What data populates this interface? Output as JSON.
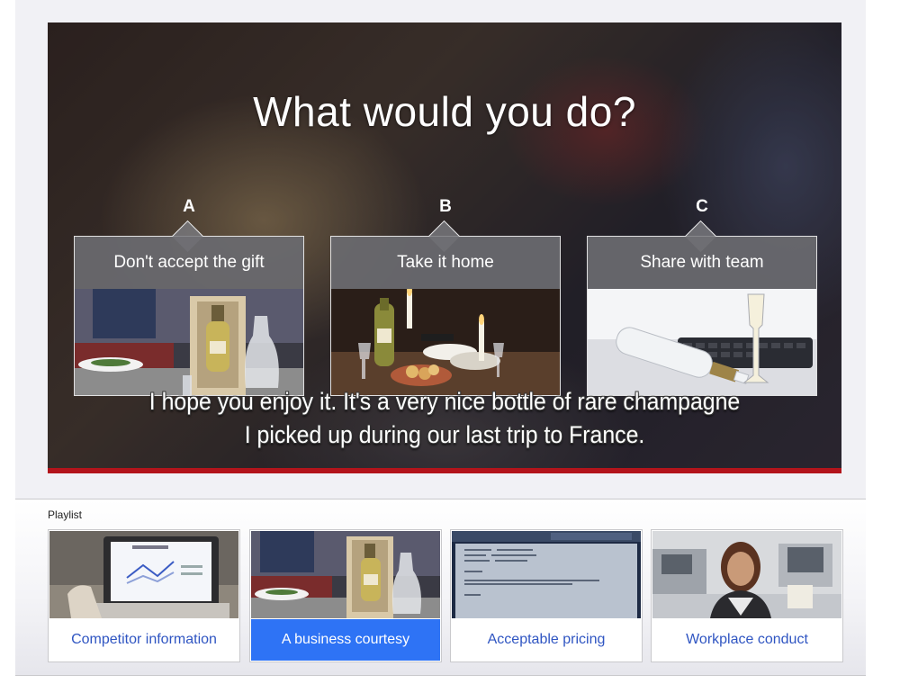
{
  "video": {
    "question": "What would you do?",
    "subtitle_line1": "I hope you enjoy it. It's a very nice bottle of rare champagne",
    "subtitle_line2": "I picked up during our last trip to France.",
    "progress": 1.0,
    "choices": [
      {
        "letter": "A",
        "label": "Don't accept the gift"
      },
      {
        "letter": "B",
        "label": "Take it home"
      },
      {
        "letter": "C",
        "label": "Share with team"
      }
    ]
  },
  "playlist": {
    "title": "Playlist",
    "items": [
      {
        "label": "Competitor information",
        "active": false
      },
      {
        "label": "A business courtesy",
        "active": true
      },
      {
        "label": "Acceptable pricing",
        "active": false
      },
      {
        "label": "Workplace conduct",
        "active": false
      }
    ]
  },
  "colors": {
    "accent": "#2e73f5",
    "link": "#2f55c2",
    "progress": "#b3141b"
  }
}
